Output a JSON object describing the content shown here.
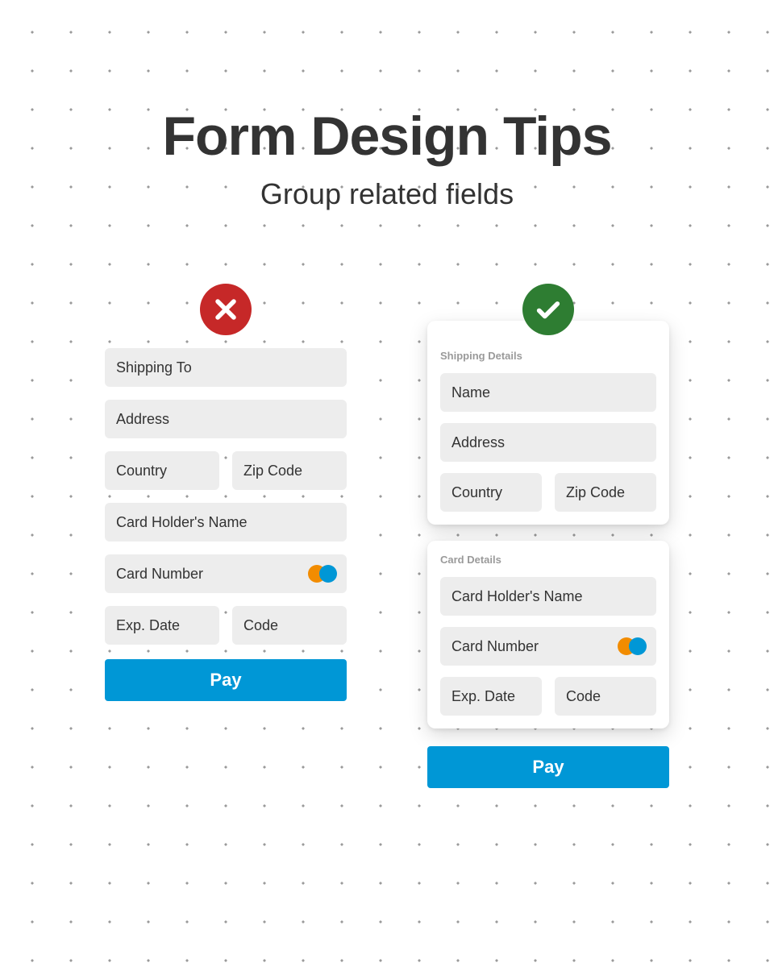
{
  "header": {
    "title": "Form Design Tips",
    "subtitle": "Group related fields"
  },
  "bad": {
    "fields": {
      "shipping_to": "Shipping To",
      "address": "Address",
      "country": "Country",
      "zip": "Zip Code",
      "card_holder": "Card Holder's Name",
      "card_number": "Card Number",
      "exp": "Exp. Date",
      "code": "Code"
    },
    "pay_label": "Pay"
  },
  "good": {
    "groups": {
      "shipping": {
        "label": "Shipping Details",
        "fields": {
          "name": "Name",
          "address": "Address",
          "country": "Country",
          "zip": "Zip Code"
        }
      },
      "card": {
        "label": "Card Details",
        "fields": {
          "card_holder": "Card Holder's Name",
          "card_number": "Card Number",
          "exp": "Exp. Date",
          "code": "Code"
        }
      }
    },
    "pay_label": "Pay"
  },
  "colors": {
    "bad_badge": "#C62828",
    "good_badge": "#2E7D32",
    "primary": "#0097D6",
    "field_bg": "#ededed",
    "card_logo_left": "#F28C00",
    "card_logo_right": "#0097D6"
  }
}
